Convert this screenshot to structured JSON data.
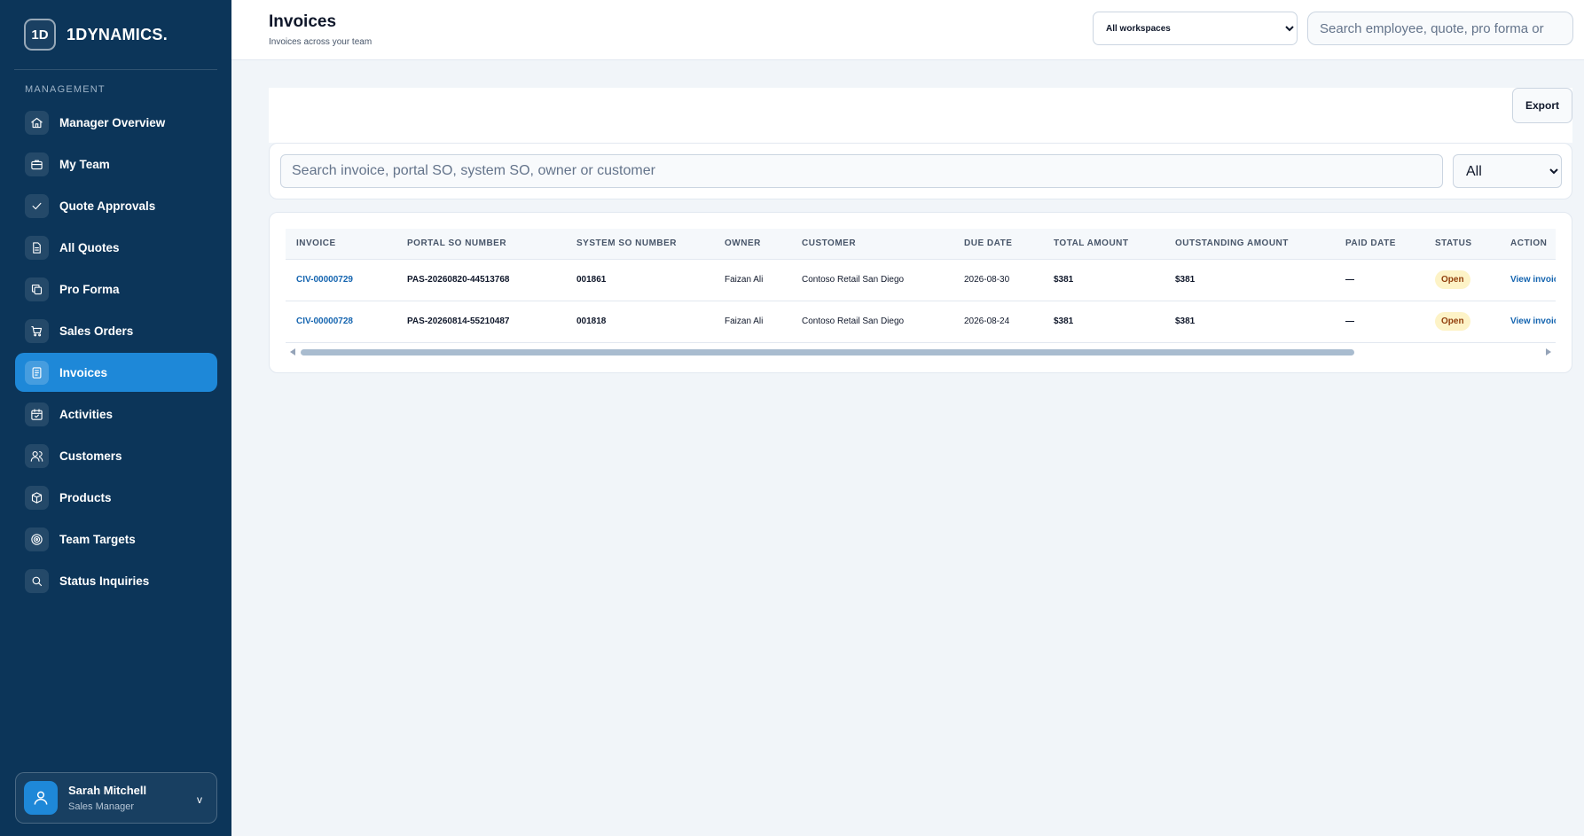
{
  "brand": {
    "logo_text": "1D",
    "name": "1DYNAMICS."
  },
  "sidebar": {
    "section_label": "MANAGEMENT",
    "items": [
      {
        "label": "Manager Overview",
        "icon": "home-icon",
        "active": false
      },
      {
        "label": "My Team",
        "icon": "briefcase-icon",
        "active": false
      },
      {
        "label": "Quote Approvals",
        "icon": "check-icon",
        "active": false
      },
      {
        "label": "All Quotes",
        "icon": "document-icon",
        "active": false
      },
      {
        "label": "Pro Forma",
        "icon": "copy-icon",
        "active": false
      },
      {
        "label": "Sales Orders",
        "icon": "cart-icon",
        "active": false
      },
      {
        "label": "Invoices",
        "icon": "invoice-icon",
        "active": true
      },
      {
        "label": "Activities",
        "icon": "calendar-check-icon",
        "active": false
      },
      {
        "label": "Customers",
        "icon": "users-icon",
        "active": false
      },
      {
        "label": "Products",
        "icon": "box-icon",
        "active": false
      },
      {
        "label": "Team Targets",
        "icon": "target-icon",
        "active": false
      },
      {
        "label": "Status Inquiries",
        "icon": "search-icon",
        "active": false
      }
    ],
    "user": {
      "name": "Sarah Mitchell",
      "role": "Sales Manager",
      "caret": "v"
    }
  },
  "header": {
    "title": "Invoices",
    "subtitle": "Invoices across your team",
    "workspace_select": {
      "selected": "All workspaces"
    },
    "search": {
      "placeholder": "Search employee, quote, pro forma or"
    }
  },
  "toolbar": {
    "export_label": "Export"
  },
  "filters": {
    "search_placeholder": "Search invoice, portal SO, system SO, owner or customer",
    "status_selected": "All"
  },
  "table": {
    "columns": [
      "INVOICE",
      "PORTAL SO NUMBER",
      "SYSTEM SO NUMBER",
      "OWNER",
      "CUSTOMER",
      "DUE DATE",
      "TOTAL AMOUNT",
      "OUTSTANDING AMOUNT",
      "PAID DATE",
      "STATUS",
      "ACTION"
    ],
    "rows": [
      {
        "invoice": "CIV-00000729",
        "portal_so": "PAS-20260820-44513768",
        "system_so": "001861",
        "owner": "Faizan Ali",
        "customer": "Contoso Retail San Diego",
        "due_date": "2026-08-30",
        "total": "$381",
        "outstanding": "$381",
        "paid_date": "—",
        "status": "Open",
        "action": "View invoice"
      },
      {
        "invoice": "CIV-00000728",
        "portal_so": "PAS-20260814-55210487",
        "system_so": "001818",
        "owner": "Faizan Ali",
        "customer": "Contoso Retail San Diego",
        "due_date": "2026-08-24",
        "total": "$381",
        "outstanding": "$381",
        "paid_date": "—",
        "status": "Open",
        "action": "View invoice"
      }
    ],
    "scroll_position": 0.0,
    "scroll_visible_fraction": 0.85
  },
  "colors": {
    "sidebar_bg": "#0c3559",
    "accent": "#1e88d8",
    "link": "#1565b0",
    "status_open_bg": "#fdf3c7",
    "status_open_text": "#92400e"
  }
}
